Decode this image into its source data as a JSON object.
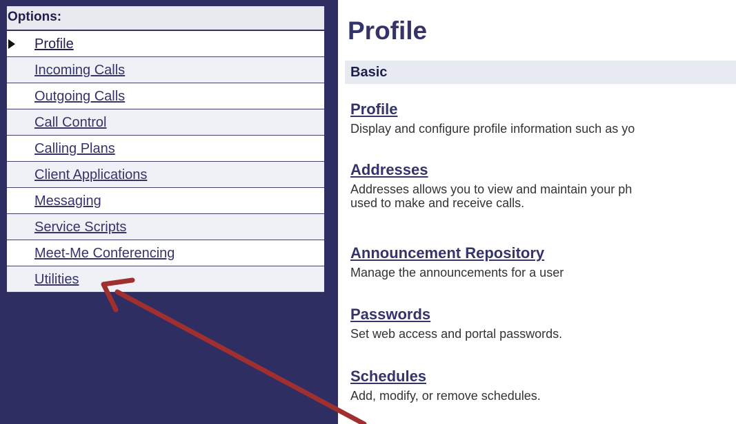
{
  "sidebar": {
    "header": "Options:",
    "items": [
      {
        "label": "Profile",
        "active": true
      },
      {
        "label": "Incoming Calls"
      },
      {
        "label": "Outgoing Calls"
      },
      {
        "label": "Call Control"
      },
      {
        "label": "Calling Plans"
      },
      {
        "label": "Client Applications"
      },
      {
        "label": "Messaging"
      },
      {
        "label": "Service Scripts"
      },
      {
        "label": "Meet-Me Conferencing"
      },
      {
        "label": "Utilities"
      }
    ]
  },
  "main": {
    "title": "Profile",
    "section": "Basic",
    "entries": [
      {
        "link": "Profile",
        "desc": "Display and configure profile information such as yo"
      },
      {
        "link": "Addresses",
        "desc": "Addresses allows you to view and maintain your ph",
        "desc2": "used to make and receive calls."
      },
      {
        "link": "Announcement Repository",
        "desc": "Manage the announcements for a user"
      },
      {
        "link": "Passwords",
        "desc": "Set web access and portal passwords."
      },
      {
        "link": "Schedules",
        "desc": "Add, modify, or remove schedules."
      }
    ]
  },
  "colors": {
    "sidebar_bg": "#2e2e62",
    "link": "#34346a",
    "annotation_arrow": "#a03030"
  }
}
